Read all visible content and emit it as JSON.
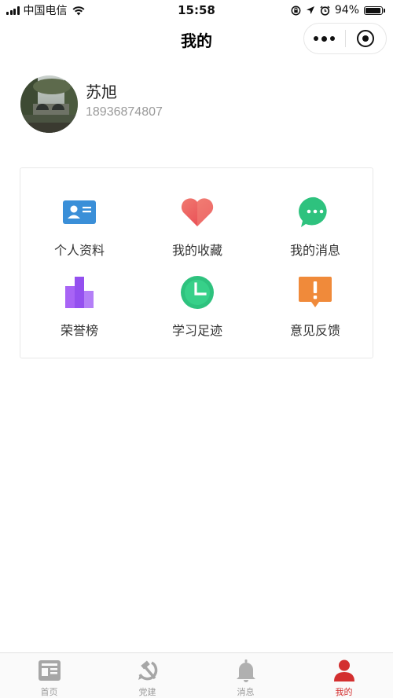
{
  "status_bar": {
    "carrier": "中国电信",
    "time": "15:58",
    "battery_percent": "94%",
    "battery_level": 0.94
  },
  "nav": {
    "title": "我的"
  },
  "profile": {
    "name": "苏旭",
    "phone": "18936874807"
  },
  "menu": [
    {
      "label": "个人资料",
      "icon": "id-card-icon",
      "color": "#3a8fd8"
    },
    {
      "label": "我的收藏",
      "icon": "heart-icon",
      "color": "#f0555a"
    },
    {
      "label": "我的消息",
      "icon": "chat-bubble-icon",
      "color": "#2ec27e"
    },
    {
      "label": "荣誉榜",
      "icon": "bar-chart-icon",
      "color": "#9b55f0"
    },
    {
      "label": "学习足迹",
      "icon": "clock-icon",
      "color": "#2ec27e"
    },
    {
      "label": "意见反馈",
      "icon": "feedback-icon",
      "color": "#f08a3a"
    }
  ],
  "tabs": [
    {
      "label": "首页",
      "icon": "news-icon"
    },
    {
      "label": "党建",
      "icon": "hammer-sickle-icon"
    },
    {
      "label": "消息",
      "icon": "bell-icon"
    },
    {
      "label": "我的",
      "icon": "person-icon",
      "active": true
    }
  ],
  "colors": {
    "active_tab": "#d32f2f",
    "inactive_tab": "#9b9b9b"
  }
}
